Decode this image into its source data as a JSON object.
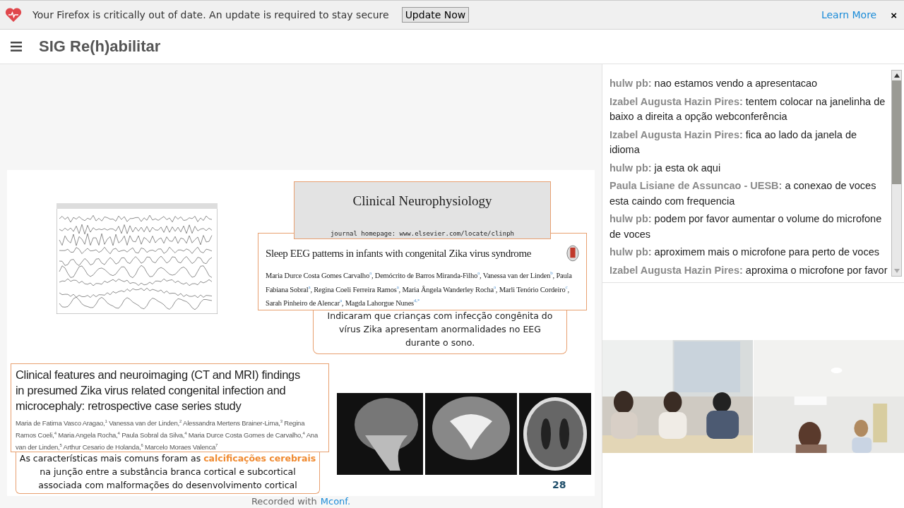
{
  "notification": {
    "message": "Your Firefox is critically out of date. An update is required to stay secure",
    "button": "Update Now",
    "link": "Learn More",
    "close": "×"
  },
  "header": {
    "title": "SIG Re(h)abilitar"
  },
  "slide": {
    "journal": {
      "title": "Clinical Neurophysiology",
      "homepage": "journal homepage: www.elsevier.com/locate/clinph"
    },
    "article_1": {
      "title": "Sleep EEG patterns in infants with congenital Zika virus syndrome",
      "authors": "Maria Durce Costa Gomes Carvalho$^{a}$, Demócrito de Barros Miranda-Filho$^{a}$, Vanessa van der Linden$^{b}$, Paula Fabiana Sobral$^{a}$, Regina Coeli Ferreira Ramos$^{a}$, Maria Ângela Wanderley Rocha$^{a}$, Marli Tenório Cordeiro$^{c}$, Sarah Pinheiro de Alencar$^{a}$, Magda Lahorgue Nunes$^{d,*}$"
    },
    "summary_1": "Indicaram que crianças com infecção congênita do vírus Zika apresentam anormalidades no EEG durante o sono.",
    "article_2": {
      "title": "Clinical features and neuroimaging (CT and MRI) findings in presumed Zika virus related congenital infection and microcephaly: retrospective case series study",
      "authors": "Maria de Fatima Vasco Aragao,$^{1}$ Vanessa van der Linden,$^{2}$ Alessandra Mertens Brainer-Lima,$^{3}$ Regina Ramos Coeli,$^{4}$ Maria Angela Rocha,$^{4}$ Paula Sobral da Silva,$^{4}$ Maria Durce Costa Gomes de Carvalho,$^{4}$ Ana van der Linden,$^{5}$ Arthur Cesario de Holanda,$^{6}$ Marcelo Moraes Valenca$^{7}$"
    },
    "summary_2": "As características mais comuns foram as **calcificações cerebrais** na junção entre a substância branca cortical e subcortical associada com malformações do desenvolvimento cortical",
    "page_number": "28"
  },
  "chat": {
    "messages": [
      {
        "author": "hulw pb:",
        "text": "nao estamos vendo a apresentacao"
      },
      {
        "author": "Izabel Augusta Hazin Pires:",
        "text": "tentem colocar na janelinha de baixo a direita a opção webconferência"
      },
      {
        "author": "Izabel Augusta Hazin Pires:",
        "text": "fica ao lado da janela de idioma"
      },
      {
        "author": "hulw pb:",
        "text": "ja esta ok aqui"
      },
      {
        "author": "Paula Lisiane de Assuncao - UESB:",
        "text": "a conexao de voces esta caindo com frequencia"
      },
      {
        "author": "hulw pb:",
        "text": "podem por favor aumentar o volume do microfone de voces"
      },
      {
        "author": "hulw pb:",
        "text": "aproximem mais o microfone para perto de voces"
      },
      {
        "author": "Izabel Augusta Hazin Pires:",
        "text": "aproxima o microfone por favor"
      }
    ]
  },
  "footer": {
    "prefix": "Recorded with",
    "link": "Mconf."
  }
}
